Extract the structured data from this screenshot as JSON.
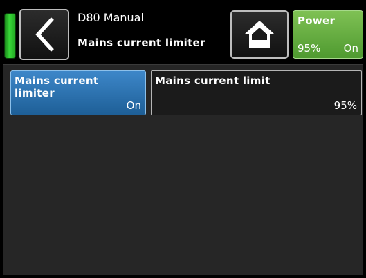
{
  "header": {
    "device_title": "D80 Manual",
    "page_title": "Mains current limiter"
  },
  "icons": {
    "back": "chevron-left-icon",
    "home": "home-icon"
  },
  "power": {
    "label": "Power",
    "percent": "95%",
    "state": "On",
    "color": "#5fab3c"
  },
  "status_led": {
    "color": "#39d839"
  },
  "tiles": [
    {
      "label": "Mains current limiter",
      "value": "On",
      "color": "#2f78b8"
    },
    {
      "label": "Mains current limit",
      "value": "95%"
    }
  ]
}
